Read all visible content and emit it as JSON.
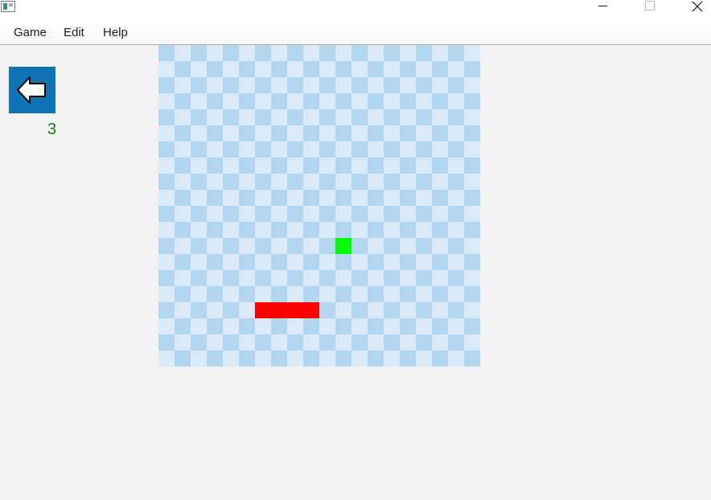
{
  "menu": {
    "items": [
      {
        "label": "Game"
      },
      {
        "label": "Edit"
      },
      {
        "label": "Help"
      }
    ]
  },
  "window_controls": {
    "minimize_icon": "minimize-icon",
    "maximize_icon": "maximize-icon",
    "close_icon": "close-icon"
  },
  "sidebar": {
    "back_icon": "arrow-left-icon",
    "back_color": "#0f73b6",
    "score": "3",
    "score_color": "#1a7a1a"
  },
  "board": {
    "columns": 20,
    "rows": 20,
    "tile_light": "#dbeaf7",
    "tile_dark": "#b2d5f0",
    "food": {
      "col": 11,
      "row": 12,
      "color": "#00ff00"
    },
    "snake": {
      "color": "#ff0000",
      "segments": [
        {
          "col": 6,
          "row": 16
        },
        {
          "col": 7,
          "row": 16
        },
        {
          "col": 8,
          "row": 16
        },
        {
          "col": 9,
          "row": 16
        }
      ]
    }
  }
}
